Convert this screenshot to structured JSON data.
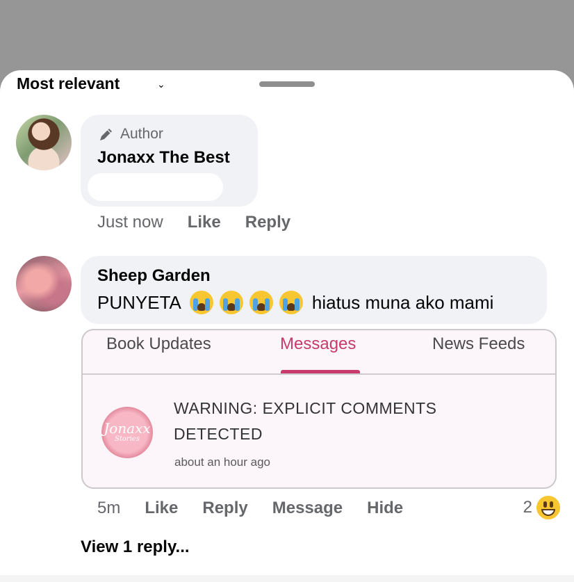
{
  "header": {
    "sort_label": "Most relevant",
    "sort_caret": "⌄"
  },
  "comments": [
    {
      "badge": "Author",
      "name": "Jonaxx The Best",
      "meta": {
        "time": "Just now",
        "like": "Like",
        "reply": "Reply"
      }
    },
    {
      "name": "Sheep Garden",
      "text_before": "PUNYETA",
      "emoji_count": 4,
      "emoji_name": "loudly-crying-face",
      "text_after": "hiatus muna ako mami",
      "attachment": {
        "tabs": [
          "Book Updates",
          "Messages",
          "News Feeds"
        ],
        "active_tab": "Messages",
        "logo_text_1": "Jonaxx",
        "logo_text_2": "Stories",
        "message": "WARNING: EXPLICIT COMMENTS DETECTED",
        "time": "about an hour ago"
      },
      "meta": {
        "time": "5m",
        "like": "Like",
        "reply": "Reply",
        "message": "Message",
        "hide": "Hide"
      },
      "reaction_count": "2",
      "reaction_icon": "grinning-squinting-face",
      "view_replies": "View 1 reply..."
    }
  ],
  "colors": {
    "backdrop": "#969696",
    "bubble": "#f0f2f5",
    "accent_tab": "#c83a6b",
    "muted_text": "#65676b"
  }
}
